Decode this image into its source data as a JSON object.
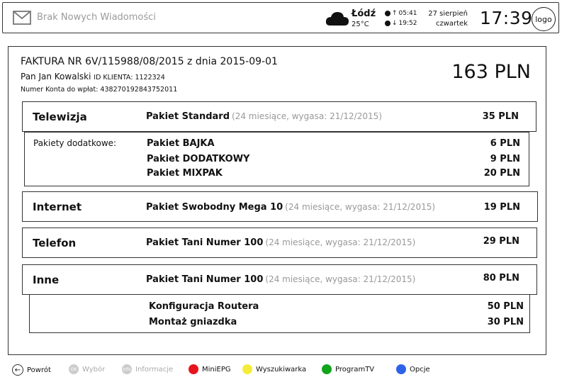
{
  "topbar": {
    "messages": "Brak Nowych Wiadomości",
    "city": "Łódź",
    "temperature": "25°C",
    "sunrise": "05:41",
    "sunset": "19:52",
    "date": "27 sierpień",
    "weekday": "czwartek",
    "time": "17:39",
    "logo": "logo"
  },
  "invoice": {
    "title": "FAKTURA NR 6V/115988/08/2015 z dnia 2015-09-01",
    "client_name": "Pan Jan Kowalski",
    "client_id": "ID KLIENTA: 1122324",
    "account": "Numer Konta do wpłat: 438270192843752011",
    "total": "163 PLN"
  },
  "sections": {
    "tv": {
      "name": "Telewizja",
      "package": "Pakiet Standard",
      "note": "(24 miesiące, wygasa: 21/12/2015)",
      "price": "35 PLN",
      "extra_label": "Pakiety dodatkowe:",
      "extras": [
        {
          "name": "Pakiet BAJKA",
          "price": "6 PLN"
        },
        {
          "name": "Pakiet DODATKOWY",
          "price": "9 PLN"
        },
        {
          "name": "Pakiet MIXPAK",
          "price": "20 PLN"
        }
      ]
    },
    "internet": {
      "name": "Internet",
      "package": "Pakiet Swobodny Mega 10",
      "note": "(24 miesiące, wygasa: 21/12/2015)",
      "price": "19 PLN"
    },
    "phone": {
      "name": "Telefon",
      "package": "Pakiet Tani Numer 100",
      "note": "(24 miesiące, wygasa: 21/12/2015)",
      "price": "29 PLN"
    },
    "other": {
      "name": "Inne",
      "package": "Pakiet Tani Numer 100",
      "note": "(24 miesiące, wygasa: 21/12/2015)",
      "price": "80 PLN",
      "extras": [
        {
          "name": "Konfiguracja Routera",
          "price": "50 PLN"
        },
        {
          "name": "Montaż gniazdka",
          "price": "30 PLN"
        }
      ]
    }
  },
  "legend": {
    "back": "Powrót",
    "ok_badge": "OK",
    "ok": "Wybór",
    "info_badge": "Info",
    "info": "Informacje",
    "red": "MiniEPG",
    "yellow": "Wyszukiwarka",
    "green": "ProgramTV",
    "blue": "Opcje"
  },
  "colors": {
    "red": "#e8141c",
    "yellow": "#f5ec3a",
    "green": "#12a41c",
    "blue": "#2d63e8",
    "dim": "#cccccc"
  }
}
